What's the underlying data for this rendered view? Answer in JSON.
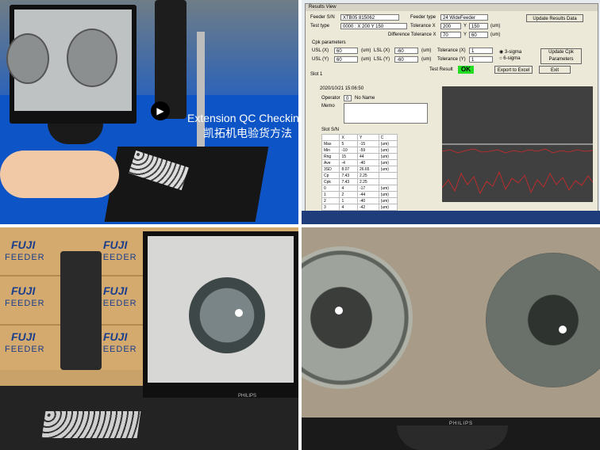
{
  "panel1": {
    "caption_en": "Extension QC Checking",
    "caption_zh": "凯拓机电验货方法"
  },
  "panel2": {
    "window_title": "Results View",
    "feeder_sn_label": "Feeder S/N",
    "feeder_sn_value": "XTB05 815062",
    "feeder_type_label": "Feeder type",
    "feeder_type_value": "24 WideFeeder",
    "update_results_button": "Update Results Data",
    "test_type_label": "Test type",
    "test_type_value": "0000 : X 200 Y 150",
    "tolerance_x_label": "Tolerance X",
    "tolerance_x_value": "200",
    "tolerance_y_label": "Y",
    "tolerance_y_value": "150",
    "tolerance_unit": "(um)",
    "diff_tolerance_label": "Difference Tolerance X",
    "diff_tolerance_x_value": "70",
    "diff_tolerance_y_label": "Y",
    "diff_tolerance_y_value": "60",
    "cpk_label": "Cpk parameters",
    "usl_x_label": "USL (X)",
    "usl_x_value": "60",
    "lsl_x_label": "LSL (X)",
    "lsl_x_value": "-60",
    "usl_y_label": "USL (Y)",
    "usl_y_value": "60",
    "lsl_y_label": "LSL (Y)",
    "lsl_y_value": "-60",
    "unit_um": "(um)",
    "tol_x_label": "Tolerance (X)",
    "tol_x_value": "1",
    "tol_y_label": "Tolerance (Y)",
    "tol_y_value": "1",
    "radio_3sigma": "3-sigma",
    "radio_6sigma": "6-sigma",
    "update_cpk_button": "Update Cpk Parameters",
    "slot_tab": "Slot 1",
    "test_result_label": "Test Result",
    "test_result_value": "OK",
    "export_button": "Export to Excel",
    "exit_button": "Exit",
    "timestamp": "2020/10/21 15:06:50",
    "operator_label": "Operator",
    "operator_value": "0",
    "operator_name": "No Name",
    "memo_label": "Memo",
    "slot_sn_label": "Slot S/N",
    "table_header": [
      "",
      "X",
      "Y",
      "C"
    ],
    "table_rows": [
      [
        "Max",
        "5",
        "-15",
        "(um)"
      ],
      [
        "Min",
        "-10",
        "-59",
        "(um)"
      ],
      [
        "Rng",
        "15",
        "44",
        "(um)"
      ],
      [
        "Ave",
        "-4",
        "-40",
        "(um)"
      ],
      [
        "3SD",
        "8.07",
        "26.65",
        "(um)"
      ],
      [
        "Cp",
        "7.43",
        "2.25",
        ""
      ],
      [
        "Cpk",
        "7.43",
        "2.25",
        ""
      ],
      [
        "0",
        "4",
        "-17",
        "(um)"
      ],
      [
        "1",
        "2",
        "-44",
        "(um)"
      ],
      [
        "2",
        "1",
        "-40",
        "(um)"
      ],
      [
        "3",
        "4",
        "-42",
        "(um)"
      ],
      [
        "4",
        "5",
        "-46",
        "(um)"
      ]
    ]
  },
  "panel3": {
    "box_brand": "FUJI",
    "box_text": "FEEDER",
    "monitor_brand": "PHILIPS"
  },
  "panel4": {
    "monitor_brand": "PHILIPS"
  }
}
